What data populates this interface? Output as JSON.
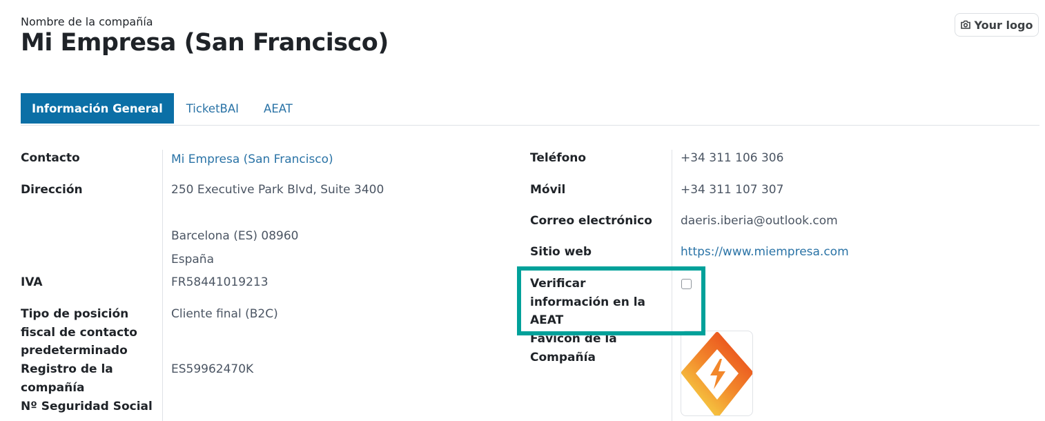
{
  "header": {
    "company_label": "Nombre de la compañía",
    "company_name": "Mi Empresa (San Francisco)",
    "logo_button": "Your logo"
  },
  "tabs": [
    {
      "label": "Información General",
      "active": true
    },
    {
      "label": "TicketBAI",
      "active": false
    },
    {
      "label": "AEAT",
      "active": false
    }
  ],
  "left": {
    "contacto": {
      "label": "Contacto",
      "value": "Mi Empresa (San Francisco)"
    },
    "direccion": {
      "label": "Dirección",
      "line1": "250 Executive Park Blvd, Suite 3400",
      "line2": "Barcelona (ES)  08960",
      "line3": "España"
    },
    "iva": {
      "label": "IVA",
      "value": "FR58441019213"
    },
    "tipo_posicion": {
      "label_line1": "Tipo de posición",
      "label_line2": "fiscal de contacto",
      "label_line3": "predeterminado",
      "value": "Cliente final (B2C)"
    },
    "registro": {
      "label_line1": "Registro de la",
      "label_line2": "compañía",
      "value": "ES59962470K"
    },
    "seguridad_social": {
      "label": "Nº Seguridad Social"
    }
  },
  "right": {
    "telefono": {
      "label": "Teléfono",
      "value": "+34 311 106 306"
    },
    "movil": {
      "label": "Móvil",
      "value": "+34 311 107 307"
    },
    "correo": {
      "label": "Correo electrónico",
      "value": "daeris.iberia@outlook.com"
    },
    "sitio_web": {
      "label": "Sitio web",
      "value": "https://www.miempresa.com"
    },
    "verificar": {
      "label_line1": "Verificar",
      "label_line2": "información en la",
      "label_line3": "AEAT",
      "checked": false
    },
    "favicon": {
      "label_line1": "Favicon de la",
      "label_line2": "Compañía",
      "icon": "lightning-bolt-diamond-icon"
    }
  },
  "colors": {
    "accent": "#0b6fa6",
    "link": "#2a73a6",
    "highlight": "#00a19a"
  }
}
